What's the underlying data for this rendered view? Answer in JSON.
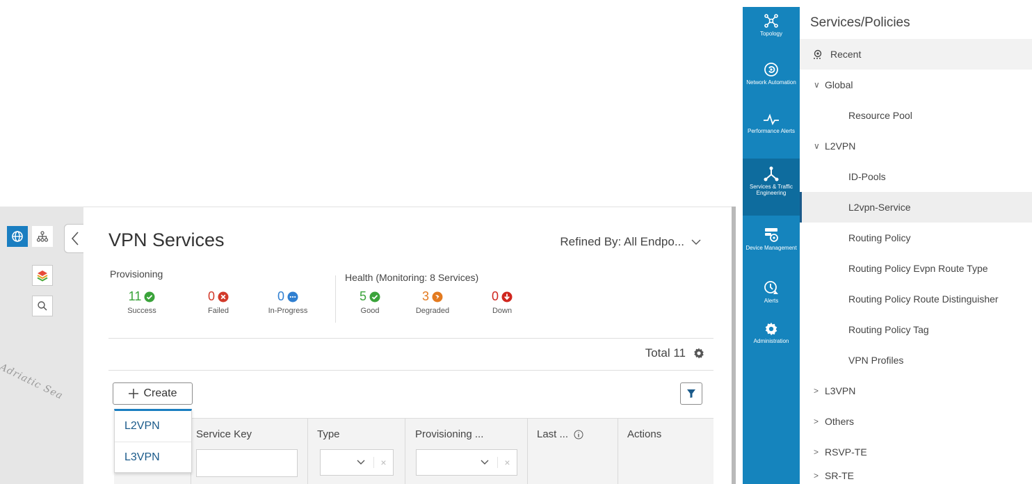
{
  "map": {
    "label": "Adriatic Sea"
  },
  "vpn_panel": {
    "title": "VPN Services",
    "refined_by": "Refined By: All Endpo...",
    "provisioning": {
      "label": "Provisioning",
      "stats": [
        {
          "value": "11",
          "label": "Success",
          "color": "#3aa33a"
        },
        {
          "value": "0",
          "label": "Failed",
          "color": "#d23a2a"
        },
        {
          "value": "0",
          "label": "In-Progress",
          "color": "#2f7fd1"
        }
      ]
    },
    "health": {
      "label": "Health (Monitoring: 8 Services)",
      "stats": [
        {
          "value": "5",
          "label": "Good",
          "color": "#3aa33a"
        },
        {
          "value": "3",
          "label": "Degraded",
          "color": "#e37a1f"
        },
        {
          "value": "0",
          "label": "Down",
          "color": "#d0261e"
        }
      ]
    },
    "total": "Total 11",
    "create_label": "Create",
    "create_menu": [
      "L2VPN",
      "L3VPN"
    ],
    "columns": [
      "Service Key",
      "Type",
      "Provisioning ...",
      "Last ...",
      "Actions"
    ]
  },
  "rail": [
    {
      "label": "Topology",
      "icon": "topology-icon"
    },
    {
      "label": "Network Automation",
      "icon": "network-automation-icon"
    },
    {
      "label": "Performance Alerts",
      "icon": "performance-alerts-icon"
    },
    {
      "label": "Services & Traffic Engineering",
      "icon": "services-icon",
      "active": true
    },
    {
      "label": "Device Management",
      "icon": "device-management-icon"
    },
    {
      "label": "Alerts",
      "icon": "alerts-icon"
    },
    {
      "label": "Administration",
      "icon": "administration-icon"
    }
  ],
  "side_panel": {
    "title": "Services/Policies",
    "recent": "Recent",
    "items": [
      {
        "label": "Global",
        "type": "group",
        "expanded": true
      },
      {
        "label": "Resource Pool",
        "type": "leaf"
      },
      {
        "label": "L2VPN",
        "type": "group",
        "expanded": true
      },
      {
        "label": "ID-Pools",
        "type": "leaf"
      },
      {
        "label": "L2vpn-Service",
        "type": "leaf",
        "selected": true
      },
      {
        "label": "Routing Policy",
        "type": "leaf"
      },
      {
        "label": "Routing Policy Evpn Route Type",
        "type": "leaf"
      },
      {
        "label": "Routing Policy Route Distinguisher",
        "type": "leaf"
      },
      {
        "label": "Routing Policy Tag",
        "type": "leaf"
      },
      {
        "label": "VPN Profiles",
        "type": "leaf"
      },
      {
        "label": "L3VPN",
        "type": "group",
        "expanded": false
      },
      {
        "label": "Others",
        "type": "group",
        "expanded": false
      },
      {
        "label": "RSVP-TE",
        "type": "group",
        "expanded": false
      },
      {
        "label": "SR-TE",
        "type": "group",
        "expanded": false
      }
    ]
  },
  "colors": {
    "rail": "#1584bd",
    "accent": "#1a7ec1"
  }
}
